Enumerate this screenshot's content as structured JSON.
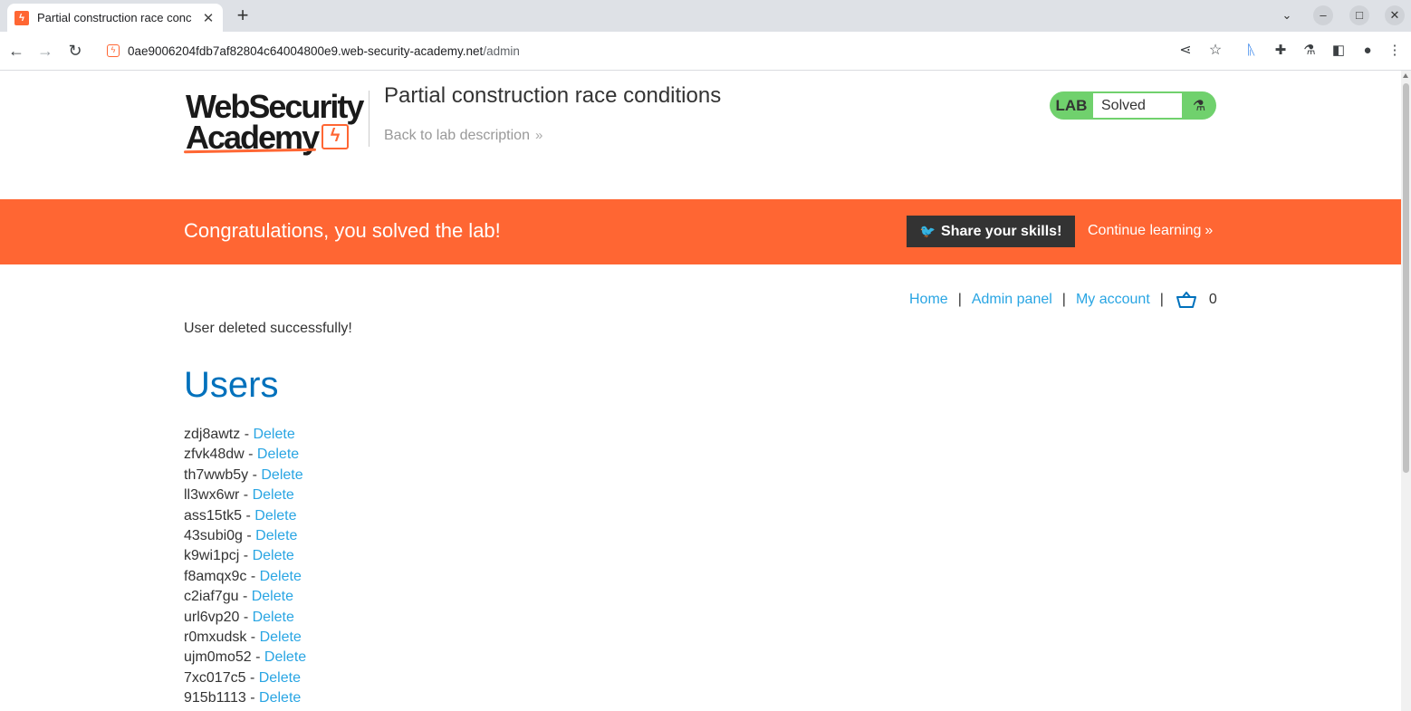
{
  "browser": {
    "tab_title": "Partial construction race conc",
    "tab_close": "✕",
    "new_tab": "+",
    "url_host": "0ae9006204fdb7af82804c64004800e9.web-security-academy.net",
    "url_path": "/admin"
  },
  "header": {
    "logo_line1": "WebSecurity",
    "logo_line2": "Academy",
    "lab_title": "Partial construction race conditions",
    "back_link": "Back to lab description",
    "lab_badge_label": "LAB",
    "lab_badge_status": "Solved"
  },
  "banner": {
    "message": "Congratulations, you solved the lab!",
    "share_label": "Share your skills!",
    "continue_label": "Continue learning"
  },
  "nav": {
    "home": "Home",
    "admin_panel": "Admin panel",
    "my_account": "My account",
    "separator": "|",
    "cart_count": "0"
  },
  "main": {
    "status_message": "User deleted successfully!",
    "users_heading": "Users",
    "delete_label": "Delete",
    "users": [
      "zdj8awtz",
      "zfvk48dw",
      "th7wwb5y",
      "ll3wx6wr",
      "ass15tk5",
      "43subi0g",
      "k9wi1pcj",
      "f8amqx9c",
      "c2iaf7gu",
      "url6vp20",
      "r0mxudsk",
      "ujm0mo52",
      "7xc017c5",
      "915b1113"
    ]
  },
  "colors": {
    "brand_orange": "#ff6633",
    "link_blue": "#29a5e3",
    "heading_blue": "#0071bc",
    "solved_green": "#70d16d"
  }
}
